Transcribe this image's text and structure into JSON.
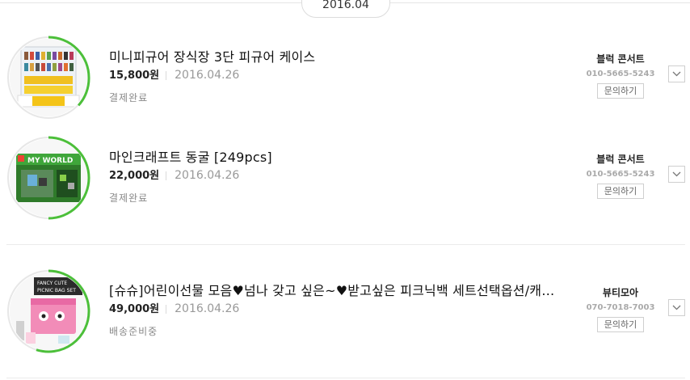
{
  "date_group": {
    "label": "2016.04"
  },
  "orders": [
    {
      "title": "미니피규어 장식장 3단 피규어 케이스",
      "price": "15,800원",
      "date": "2016.04.26",
      "status": "결제완료",
      "seller": "블럭 콘서트",
      "phone": "010-5665-5243",
      "inquiry_label": "문의하기",
      "progress": 0.3,
      "accent_color": "#4cbf3a"
    },
    {
      "title": "마인크래프트 동굴 [249pcs]",
      "price": "22,000원",
      "date": "2016.04.26",
      "status": "결제완료",
      "seller": "블럭 콘서트",
      "phone": "010-5665-5243",
      "inquiry_label": "문의하기",
      "progress": 0.4,
      "accent_color": "#4cbf3a",
      "image_text": "MY WORLD"
    },
    {
      "title": "[슈슈]어린이선물 모음♥넘나 갖고 싶은~♥받고싶은 피크닉백 세트선택옵션/캐릭터",
      "price": "49,000원",
      "date": "2016.04.26",
      "status": "배송준비중",
      "seller": "뷰티모아",
      "phone": "070-7018-7003",
      "inquiry_label": "문의하기",
      "progress": 0.55,
      "accent_color": "#4cbf3a",
      "image_text": "FANCY CUTE PICNIC BAG SET"
    }
  ],
  "icons": {
    "toggle": "chevron-down-icon"
  }
}
